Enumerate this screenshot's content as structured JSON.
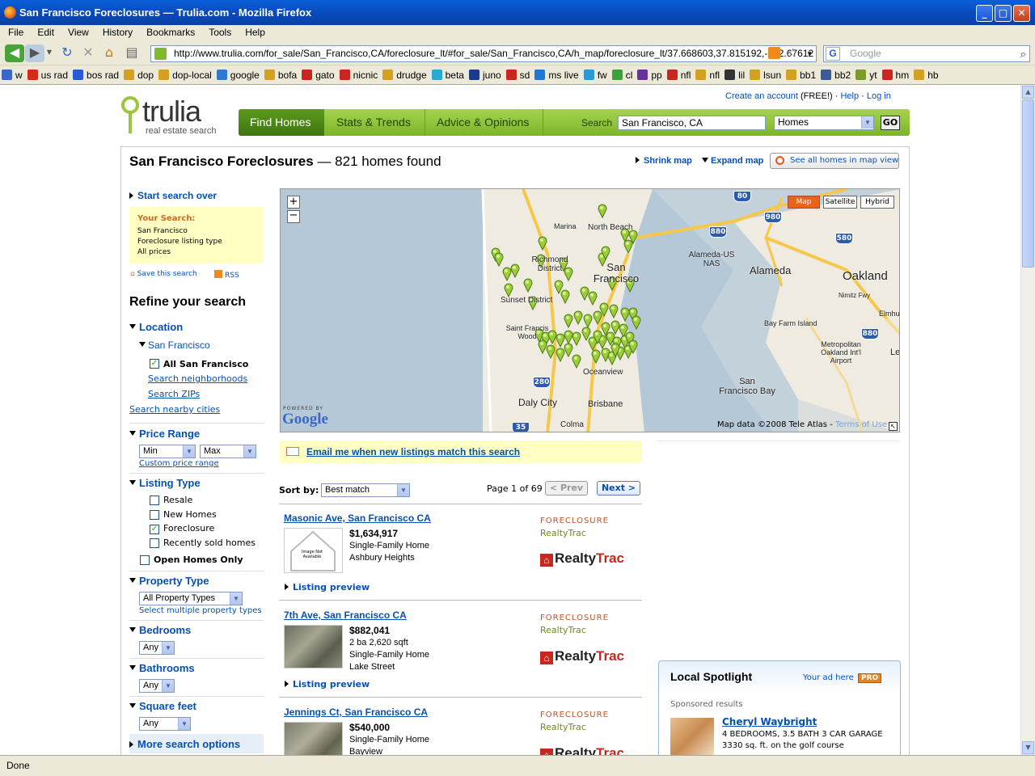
{
  "window": {
    "title": "San Francisco Foreclosures — Trulia.com - Mozilla Firefox"
  },
  "menu": [
    "File",
    "Edit",
    "View",
    "History",
    "Bookmarks",
    "Tools",
    "Help"
  ],
  "nav": {
    "url": "http://www.trulia.com/for_sale/San_Francisco,CA/foreclosure_lt/#for_sale/San_Francisco,CA/h_map/foreclosure_lt/37.668603,37.815192,-122.67612",
    "search_placeholder": "Google"
  },
  "bookmarks": [
    "w",
    "us rad",
    "bos rad",
    "dop",
    "dop-local",
    "google",
    "bofa",
    "gato",
    "nicnic",
    "drudge",
    "beta",
    "juno",
    "sd",
    "ms live",
    "fw",
    "cl",
    "pp",
    "nfl",
    "nfl",
    "lil",
    "lsun",
    "bb1",
    "bb2",
    "yt",
    "hm",
    "hb"
  ],
  "status": "Done",
  "site": {
    "logo": "trulia",
    "logo_sub": "real estate search",
    "top_links": {
      "create": "Create an account",
      "free": "(FREE!)",
      "help": "Help",
      "login": "Log in"
    },
    "tabs": [
      "Find Homes",
      "Stats & Trends",
      "Advice & Opinions"
    ],
    "search_label": "Search",
    "search_value": "San Francisco, CA",
    "search_type": "Homes",
    "go": "GO"
  },
  "header": {
    "title": "San Francisco Foreclosures",
    "count": "— 821 homes found",
    "shrink": "Shrink map",
    "expand": "Expand map",
    "see_all": "See all homes in map view"
  },
  "sidebar": {
    "start_over": "Start search over",
    "your_search_title": "Your Search:",
    "your_search_lines": [
      "San Francisco",
      "Foreclosure listing type",
      "All prices"
    ],
    "save": "Save this search",
    "rss": "RSS",
    "refine": "Refine your search",
    "location": {
      "title": "Location",
      "city": "San Francisco",
      "all": "All San Francisco",
      "neighborhoods": "Search neighborhoods",
      "zips": "Search ZIPs",
      "nearby": "Search nearby cities"
    },
    "price": {
      "title": "Price Range",
      "min": "Min",
      "max": "Max",
      "custom": "Custom price range"
    },
    "listing_type": {
      "title": "Listing Type",
      "options": [
        "Resale",
        "New Homes",
        "Foreclosure",
        "Recently sold homes"
      ],
      "checked": [
        false,
        false,
        true,
        false
      ],
      "open_homes": "Open Homes Only"
    },
    "property_type": {
      "title": "Property Type",
      "value": "All Property Types",
      "multi": "Select multiple property types"
    },
    "bedrooms": {
      "title": "Bedrooms",
      "value": "Any"
    },
    "bathrooms": {
      "title": "Bathrooms",
      "value": "Any"
    },
    "sqft": {
      "title": "Square feet",
      "value": "Any"
    },
    "more": "More search options"
  },
  "map": {
    "type_buttons": [
      "Map",
      "Satellite",
      "Hybrid"
    ],
    "labels": [
      "Marina",
      "North Beach",
      "Richmond District",
      "San Francisco",
      "Sunset District",
      "Saint Francis Wood",
      "Oceanview",
      "Daly City",
      "Brisbane",
      "Colma",
      "Alameda-US NAS",
      "Alameda",
      "Oakland",
      "Bay Farm Island",
      "Metropolitan Oakland Int'l Airport",
      "San Francisco Bay",
      "Elmhu",
      "Le",
      "Nimitz Fwy"
    ],
    "shields": [
      "80",
      "980",
      "880",
      "580",
      "880",
      "280",
      "35"
    ],
    "powered": "POWERED BY",
    "google": "Google",
    "attribution": "Map data ©2008 Tele Atlas -",
    "terms": "Terms of Use"
  },
  "email_alert": "Email me when new listings match this search",
  "sort": {
    "label": "Sort by:",
    "value": "Best match",
    "page": "Page 1 of 69",
    "prev": "< Prev",
    "next": "Next >"
  },
  "listings": [
    {
      "address": "Masonic Ave, San Francisco CA",
      "price": "$1,634,917",
      "details": [
        "Single-Family Home",
        "Ashbury Heights"
      ],
      "type": "FORECLOSURE",
      "source": "RealtyTrac",
      "preview": "Listing preview",
      "image": "Image Not Available"
    },
    {
      "address": "7th Ave, San Francisco CA",
      "price": "$882,041",
      "details": [
        "2 ba 2,620 sqft",
        "Single-Family Home",
        "Lake Street"
      ],
      "type": "FORECLOSURE",
      "source": "RealtyTrac",
      "preview": "Listing preview"
    },
    {
      "address": "Jennings Ct, San Francisco CA",
      "price": "$540,000",
      "details": [
        "Single-Family Home",
        "Bayview"
      ],
      "type": "FORECLOSURE",
      "source": "RealtyTrac"
    }
  ],
  "spotlight": {
    "title": "Local Spotlight",
    "your_ad": "Your ad here",
    "pro": "PRO",
    "sponsored": "Sponsored results",
    "agent": "Cheryl Waybright",
    "lines": [
      "4 BEDROOMS, 3.5 BATH 3 CAR GARAGE",
      "3330 sq. ft. on the golf course"
    ]
  },
  "colors": {
    "brand_green": "#7cb528",
    "link": "#0650b4",
    "tab_dark": "#4f8a16"
  }
}
